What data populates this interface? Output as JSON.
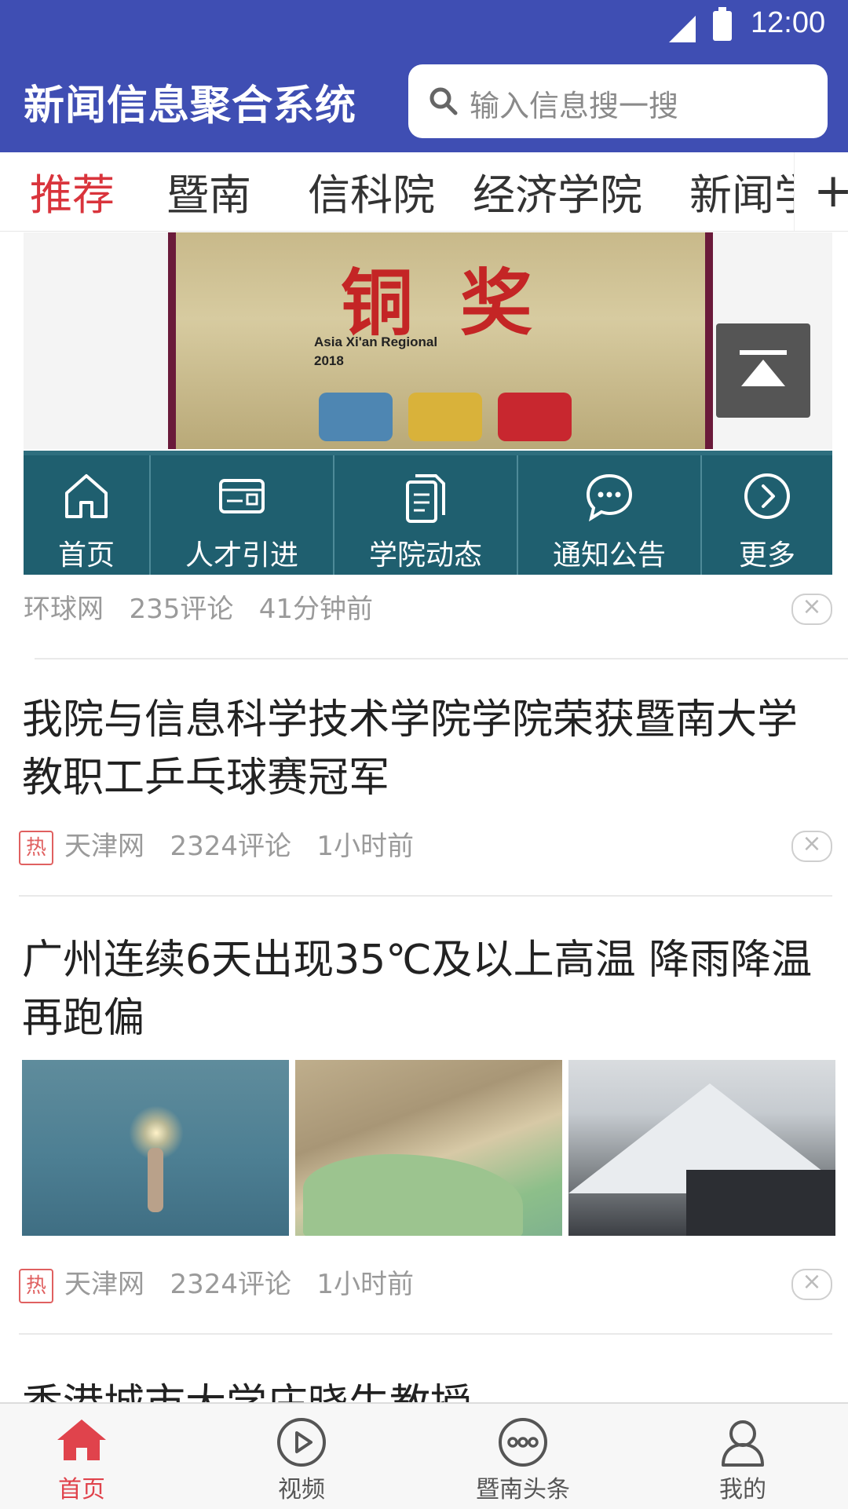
{
  "status_bar": {
    "time": "12:00",
    "icons": [
      "signal-icon",
      "battery-icon"
    ]
  },
  "header": {
    "title": "新闻信息聚合系统",
    "search_placeholder": "输入信息搜一搜"
  },
  "tabs": [
    "推荐",
    "暨南",
    "信科院",
    "经济学院",
    "新闻学院"
  ],
  "tabs_active": "推荐",
  "tabs_add_label": "+",
  "banner": {
    "award_text": "铜奖",
    "region_line1": "Asia Xi'an Regional",
    "region_line2": "2018"
  },
  "quick_nav": [
    {
      "label": "首页",
      "icon": "home-icon"
    },
    {
      "label": "人才引进",
      "icon": "id-card-icon"
    },
    {
      "label": "学院动态",
      "icon": "document-icon"
    },
    {
      "label": "通知公告",
      "icon": "chat-bubble-icon"
    },
    {
      "label": "更多",
      "icon": "chevron-right-circle-icon"
    }
  ],
  "articles": [
    {
      "source": "环球网",
      "comments": "235评论",
      "time": "41分钟前",
      "hot": false
    },
    {
      "title": "我院与信息科学技术学院学院荣获暨南大学教职工乒乓球赛冠军",
      "hot_label": "热",
      "source": "天津网",
      "comments": "2324评论",
      "time": "1小时前",
      "hot": true
    },
    {
      "title": "广州连续6天出现35℃及以上高温 降雨降温再跑偏",
      "hot_label": "热",
      "source": "天津网",
      "comments": "2324评论",
      "time": "1小时前",
      "hot": true,
      "images": [
        "sparkler-in-sea",
        "quarry-aerial",
        "snowy-mountain-village"
      ]
    },
    {
      "title": "香港城市大学庄晓生教授"
    }
  ],
  "dismiss_label": "×",
  "bottom_nav": [
    {
      "label": "首页",
      "icon": "home-icon",
      "active": true
    },
    {
      "label": "视频",
      "icon": "play-circle-icon",
      "active": false
    },
    {
      "label": "暨南头条",
      "icon": "more-circle-icon",
      "active": false
    },
    {
      "label": "我的",
      "icon": "user-icon",
      "active": false
    }
  ],
  "colors": {
    "header_bg": "#3f4eb3",
    "accent_red": "#d9343c",
    "quick_nav_bg": "#1f5f6f"
  }
}
